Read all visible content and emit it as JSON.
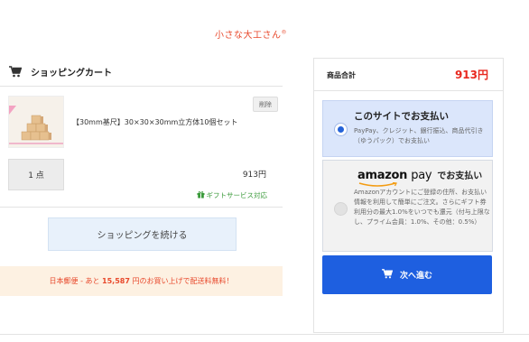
{
  "brand": {
    "name": "小さな大工さん",
    "mark": "®",
    "color": "#e8492c"
  },
  "cart": {
    "title": "ショッピングカート",
    "item": {
      "title": "【30mm基尺】30×30×30mm立方体10個セット",
      "delete_label": "削除",
      "quantity": "1 点",
      "price": "913円",
      "gift_label": "ギフトサービス対応"
    },
    "continue_label": "ショッピングを続ける",
    "shipping_notice": {
      "prefix": "日本郵便 - あと ",
      "amount": "15,587",
      "suffix": " 円のお買い上げで配送料無料！"
    }
  },
  "summary": {
    "total_label": "商品合計",
    "total_value": "913円",
    "payment_options": [
      {
        "title": "このサイトでお支払い",
        "description": "PayPay、クレジット、銀行振込、商品代引き（ゆうパック）でお支払い",
        "selected": true
      },
      {
        "logo_amazon": "amazon",
        "logo_pay": "pay",
        "title_suffix": "でお支払い",
        "description": "Amazonアカウントにご登録の住所、お支払い情報を利用して簡単にご注文。さらにギフト券利用分の最大1.0%をいつでも還元（付与上限なし、プライム会員：1.0%、その他：0.5%）",
        "selected": false
      }
    ],
    "next_label": "次へ進む"
  },
  "colors": {
    "accent": "#1e5fe0",
    "price_red": "#e8281f",
    "gift_green": "#3a9a3a",
    "notice_bg": "#fdf1e2",
    "selected_bg": "#dbe6fb"
  },
  "icons": {
    "cart": "cart-icon",
    "gift": "gift-icon",
    "next": "cart-icon"
  }
}
